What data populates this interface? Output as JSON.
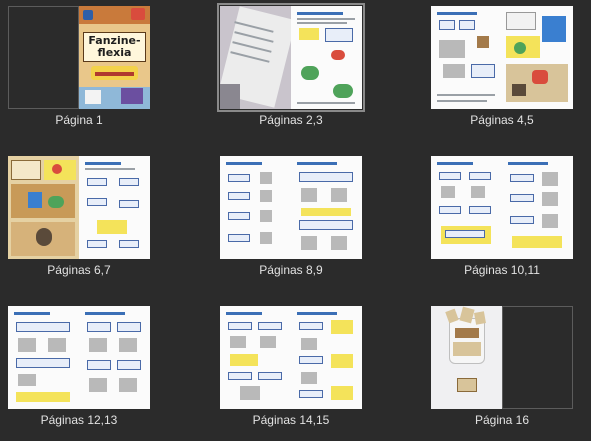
{
  "thumbnails": [
    {
      "label": "Página 1",
      "pages": [
        "blank",
        "cover"
      ],
      "selected": false,
      "cover_title": "Fanzine-\nflexia"
    },
    {
      "label": "Páginas 2,3",
      "pages": [
        "photo",
        "worksheet"
      ],
      "selected": true
    },
    {
      "label": "Páginas 4,5",
      "pages": [
        "worksheet",
        "comic"
      ],
      "selected": false
    },
    {
      "label": "Páginas 6,7",
      "pages": [
        "comic",
        "worksheet"
      ],
      "selected": false
    },
    {
      "label": "Páginas 8,9",
      "pages": [
        "worksheet",
        "worksheet"
      ],
      "selected": false
    },
    {
      "label": "Páginas 10,11",
      "pages": [
        "worksheet",
        "worksheet"
      ],
      "selected": false
    },
    {
      "label": "Páginas 12,13",
      "pages": [
        "worksheet",
        "worksheet"
      ],
      "selected": false
    },
    {
      "label": "Páginas 14,15",
      "pages": [
        "worksheet",
        "worksheet"
      ],
      "selected": false
    },
    {
      "label": "Página 16",
      "pages": [
        "photo-glass",
        "blank"
      ],
      "selected": false
    }
  ]
}
